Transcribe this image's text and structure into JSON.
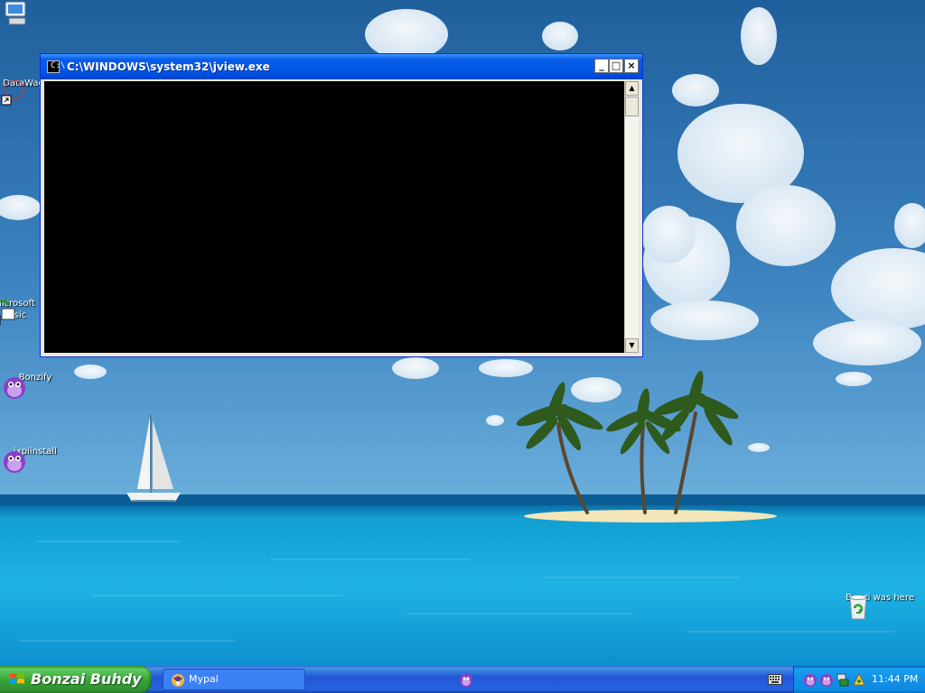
{
  "console": {
    "title": "C:\\WINDOWS\\system32\\jview.exe",
    "title_icon_glyph": "C:\\",
    "minimize_glyph": "_",
    "maximize_glyph": "□",
    "close_glyph": "×",
    "scroll_up_glyph": "▲",
    "scroll_down_glyph": "▼",
    "body_color": "#000000"
  },
  "desktop_icons": [
    {
      "label": "",
      "icon": "my-computer-icon"
    },
    {
      "label": "DataWagon...",
      "icon": "datawagon-shortcut-icon"
    },
    {
      "label": "Microsoft Basic",
      "icon": "microsoft-basic-shortcut-icon"
    },
    {
      "label": "Bonzify",
      "icon": "bonzi-gorilla-icon"
    },
    {
      "label": "jxpiinstall",
      "icon": "bonzi-gorilla-icon"
    },
    {
      "label": "Bonzi was here",
      "icon": "recycle-bin-icon"
    }
  ],
  "taskbar": {
    "start_label": "Bonzai Buhdy",
    "tasks": [
      {
        "label": "Mypal",
        "icon": "mypal-browser-icon"
      },
      {
        "label": "",
        "icon": "bonzi-gorilla-icon"
      }
    ],
    "tray": {
      "icons": [
        "bonzi-tray-icon",
        "bonzi-tray-icon",
        "network-tray-icon",
        "agent-tray-icon"
      ],
      "clock": "11:44 PM"
    }
  },
  "colors": {
    "titlebar": "#0055e5",
    "taskbar": "#2157d7",
    "start_button": "#37a237",
    "tray": "#1290e6"
  }
}
